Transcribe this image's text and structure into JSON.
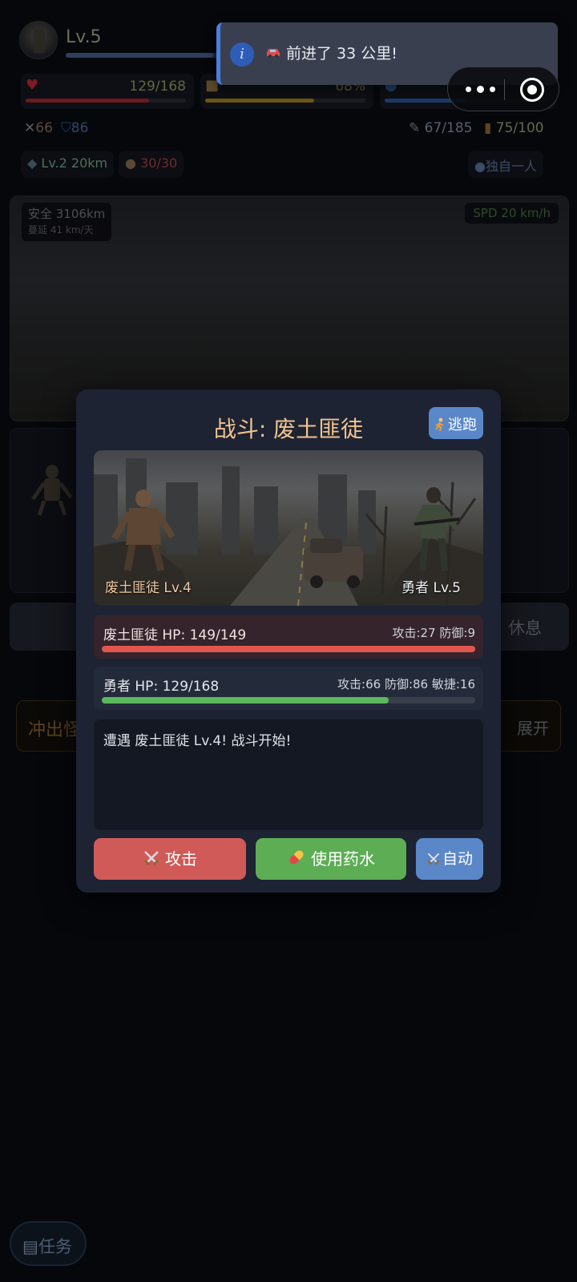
{
  "player": {
    "level": "Lv.5",
    "hp": "129/168",
    "food": "68%",
    "attack": "66",
    "defense": "86",
    "parts": "67/185",
    "fuel": "75/100",
    "car": "Lv.2 20km",
    "ammo": "30/30",
    "party": "独自一人",
    "xp_fraction": 0.92,
    "hp_fraction": 0.77,
    "food_fraction": 0.68,
    "water_fraction": 0.5
  },
  "scene": {
    "safe": "安全 3106km",
    "spread": "蔓延 41 km/天",
    "speed": "SPD 20 km/h"
  },
  "underlying": {
    "rest_label": "休息",
    "quest_title": "冲出怪",
    "expand_label": "展开",
    "task_label": "任务"
  },
  "toast": {
    "message": "前进了 33 公里!",
    "icon": "info-icon"
  },
  "battle": {
    "title": "战斗: 废土匪徒",
    "flee_label": "逃跑",
    "enemy_label": "废土匪徒 Lv.4",
    "player_label": "勇者 Lv.5",
    "enemy_hp_text": "废土匪徒 HP: 149/149",
    "enemy_stats": "攻击:27 防御:9",
    "enemy_hp_fraction": 1.0,
    "player_hp_text": "勇者 HP: 129/168",
    "player_stats": "攻击:66 防御:86 敏捷:16",
    "player_hp_fraction": 0.768,
    "log_text": "遭遇 废土匪徒 Lv.4! 战斗开始!",
    "attack_label": "攻击",
    "potion_label": "使用药水",
    "auto_label": "自动"
  },
  "colors": {
    "accent_gold": "#f1c38e",
    "attack_red": "#d05a57",
    "potion_green": "#5dad55",
    "auto_blue": "#5a87c8",
    "modal_bg": "#1d2333"
  }
}
